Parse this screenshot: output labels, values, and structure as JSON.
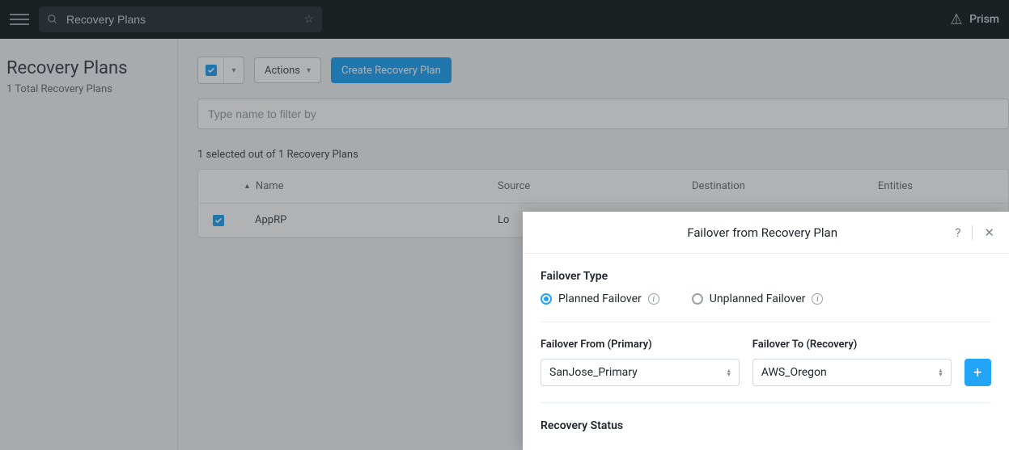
{
  "brand": "Prism",
  "search_value": "Recovery Plans",
  "sidebar": {
    "title": "Recovery Plans",
    "subtitle": "1 Total Recovery Plans"
  },
  "toolbar": {
    "actions_label": "Actions",
    "create_label": "Create Recovery Plan"
  },
  "filter_placeholder": "Type name to filter by",
  "selection_text": "1 selected out of 1 Recovery Plans",
  "table": {
    "headers": {
      "name": "Name",
      "source": "Source",
      "destination": "Destination",
      "entities": "Entities"
    },
    "rows": [
      {
        "name": "AppRP",
        "source": "Lo",
        "destination": "",
        "entities": ""
      }
    ]
  },
  "dialog": {
    "title": "Failover from Recovery Plan",
    "type_label": "Failover Type",
    "planned_label": "Planned Failover",
    "unplanned_label": "Unplanned Failover",
    "from_label": "Failover From (Primary)",
    "to_label": "Failover To (Recovery)",
    "from_value": "SanJose_Primary",
    "to_value": "AWS_Oregon",
    "recovery_status_label": "Recovery Status"
  }
}
